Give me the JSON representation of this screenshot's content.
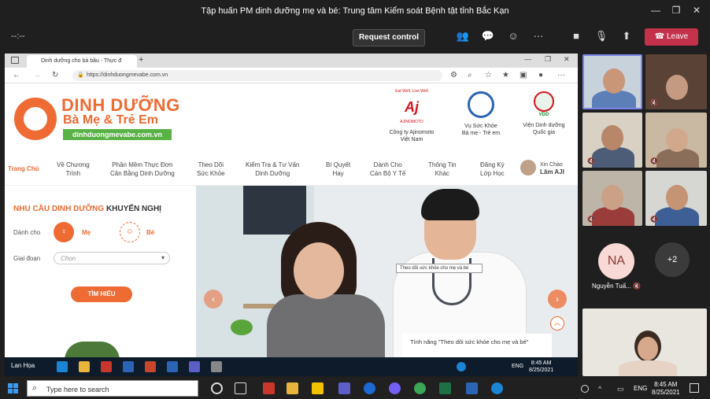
{
  "teams": {
    "title": "Tập huấn PM dinh dưỡng mẹ và bé: Trung tâm Kiểm soát Bệnh tật tỉnh Bắc Kạn",
    "timer": "--:--",
    "request_control": "Request control",
    "leave": "Leave",
    "toolbar_icons": [
      "people-icon",
      "chat-icon",
      "reactions-icon",
      "more-icon",
      "camera-icon",
      "mic-off-icon",
      "share-tray-icon"
    ]
  },
  "browser": {
    "tab_title": "Dinh dưỡng cho bà bầu - Thực đ",
    "url": "https://dinhduongmevabe.com.vn",
    "new_tab": "+"
  },
  "site": {
    "logo_line1": "DINH DƯỠNG",
    "logo_line2": "Bà Mẹ & Trẻ Em",
    "logo_url": "dinhduongmevabe.com.vn",
    "partners": [
      {
        "tagline": "Eat Well, Live Well",
        "brand": "AJINOMOTO",
        "label1": "Công ty Ajinomoto",
        "label2": "Việt Nam",
        "color": "#d7131d"
      },
      {
        "tagline": "",
        "brand": "",
        "label1": "Vụ Sức Khỏe",
        "label2": "Bà mẹ - Trẻ em",
        "color": "#2b64b4"
      },
      {
        "tagline": "",
        "brand": "VDD",
        "label1": "Viện Dinh dưỡng",
        "label2": "Quốc gia",
        "color": "#1e8a3a"
      }
    ],
    "nav": [
      {
        "l1": "Trang Chủ",
        "l2": ""
      },
      {
        "l1": "Về Chương",
        "l2": "Trình"
      },
      {
        "l1": "Phần Mềm Thực Đơn",
        "l2": "Cân Bằng Dinh Dưỡng"
      },
      {
        "l1": "Theo Dõi",
        "l2": "Sức Khỏe"
      },
      {
        "l1": "Kiểm Tra & Tư Vấn",
        "l2": "Dinh Dưỡng"
      },
      {
        "l1": "Bí Quyết",
        "l2": "Hay"
      },
      {
        "l1": "Dành Cho",
        "l2": "Cán Bộ Y Tế"
      },
      {
        "l1": "Thông Tin",
        "l2": "Khác"
      },
      {
        "l1": "Đăng Ký",
        "l2": "Lớp Học"
      }
    ],
    "greeting": "Xin Chào",
    "user": "Lâm AJI",
    "needs": {
      "title_a": "NHU CẦU DINH DƯỠNG",
      "title_b": "KHUYẾN NGHỊ",
      "for_label": "Dành cho",
      "opt_me": "Mẹ",
      "opt_be": "Bé",
      "stage_label": "Giai đoạn",
      "stage_placeholder": "Chọn",
      "find_button": "TÌM HIỂU"
    },
    "hero": {
      "tooltip": "Theo dõi sức khỏe cho mẹ và bé",
      "caption": "Tính năng \"Theo dõi sức khỏe cho mẹ và bé\""
    }
  },
  "guest_taskbar": {
    "user": "Lan Họa",
    "lang": "ENG",
    "time": "8:45 AM",
    "date": "8/25/2021"
  },
  "participants": {
    "na_initials": "NA",
    "na_name": "Nguyễn Tuấ...",
    "more": "+2"
  },
  "windows": {
    "search_placeholder": "Type here to search",
    "lang": "ENG",
    "time": "8:45 AM",
    "date": "8/25/2021"
  }
}
